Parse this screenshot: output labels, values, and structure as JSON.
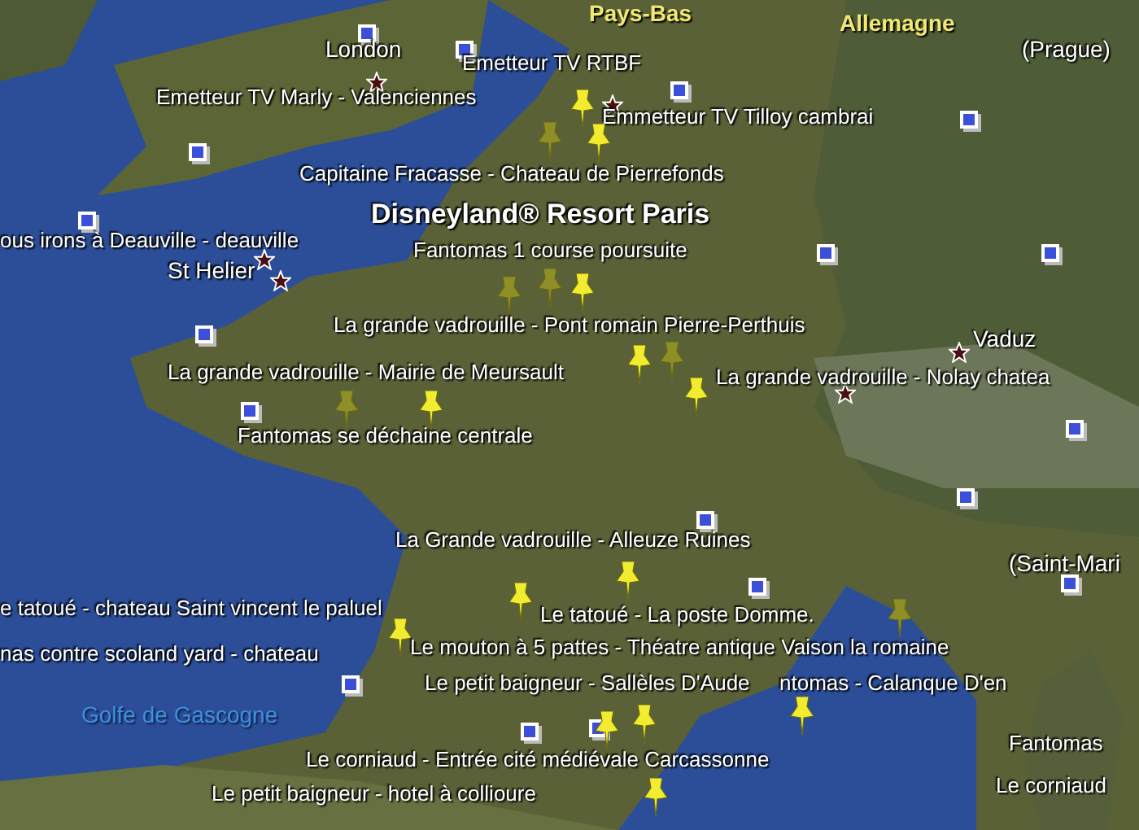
{
  "map": {
    "labels": [
      {
        "text": "Pays-Bas",
        "kind": "country"
      },
      {
        "text": "Allemagne",
        "kind": "country"
      },
      {
        "text": "London",
        "kind": "city"
      },
      {
        "text": "Emetteur TV RTBF",
        "kind": "place"
      },
      {
        "text": "(Prague)",
        "kind": "city"
      },
      {
        "text": "Emetteur TV Marly - Valenciennes",
        "kind": "place"
      },
      {
        "text": "Emmetteur TV Tilloy cambrai",
        "kind": "place"
      },
      {
        "text": "Capitaine Fracasse - Chateau de Pierrefonds",
        "kind": "place"
      },
      {
        "text": "Disneyland® Resort Paris",
        "kind": "featured"
      },
      {
        "text": "ous irons à Deauville - deauville",
        "kind": "place"
      },
      {
        "text": "Fantomas 1 course poursuite",
        "kind": "place"
      },
      {
        "text": "St Helier",
        "kind": "city"
      },
      {
        "text": "La grande vadrouille - Pont romain Pierre-Perthuis",
        "kind": "place"
      },
      {
        "text": "Vaduz",
        "kind": "city"
      },
      {
        "text": "La grande vadrouille - Mairie de Meursault",
        "kind": "place"
      },
      {
        "text": "La grande vadrouille - Nolay chatea",
        "kind": "place"
      },
      {
        "text": "Fantomas se déchaine centrale",
        "kind": "place"
      },
      {
        "text": "La Grande vadrouille - Alleuze Ruines",
        "kind": "place"
      },
      {
        "text": "(Saint-Mari",
        "kind": "city"
      },
      {
        "text": "e tatoué - chateau Saint vincent le paluel",
        "kind": "place"
      },
      {
        "text": "Le tatoué - La poste Domme.",
        "kind": "place"
      },
      {
        "text": "nas contre scoland yard - chateau",
        "kind": "place"
      },
      {
        "text": "Le mouton à 5 pattes - Théatre antique Vaison la romaine",
        "kind": "place"
      },
      {
        "text": "Le petit baigneur - Sallèles D'Aude",
        "kind": "place"
      },
      {
        "text": "ntomas - Calanque D'en",
        "kind": "place"
      },
      {
        "text": "Golfe de Gascogne",
        "kind": "sea"
      },
      {
        "text": "Fantomas",
        "kind": "place"
      },
      {
        "text": "Le corniaud - Entrée cité médiévale Carcassonne",
        "kind": "place"
      },
      {
        "text": "Le corniaud",
        "kind": "place"
      },
      {
        "text": "Le petit baigneur - hotel à collioure",
        "kind": "place"
      }
    ]
  }
}
